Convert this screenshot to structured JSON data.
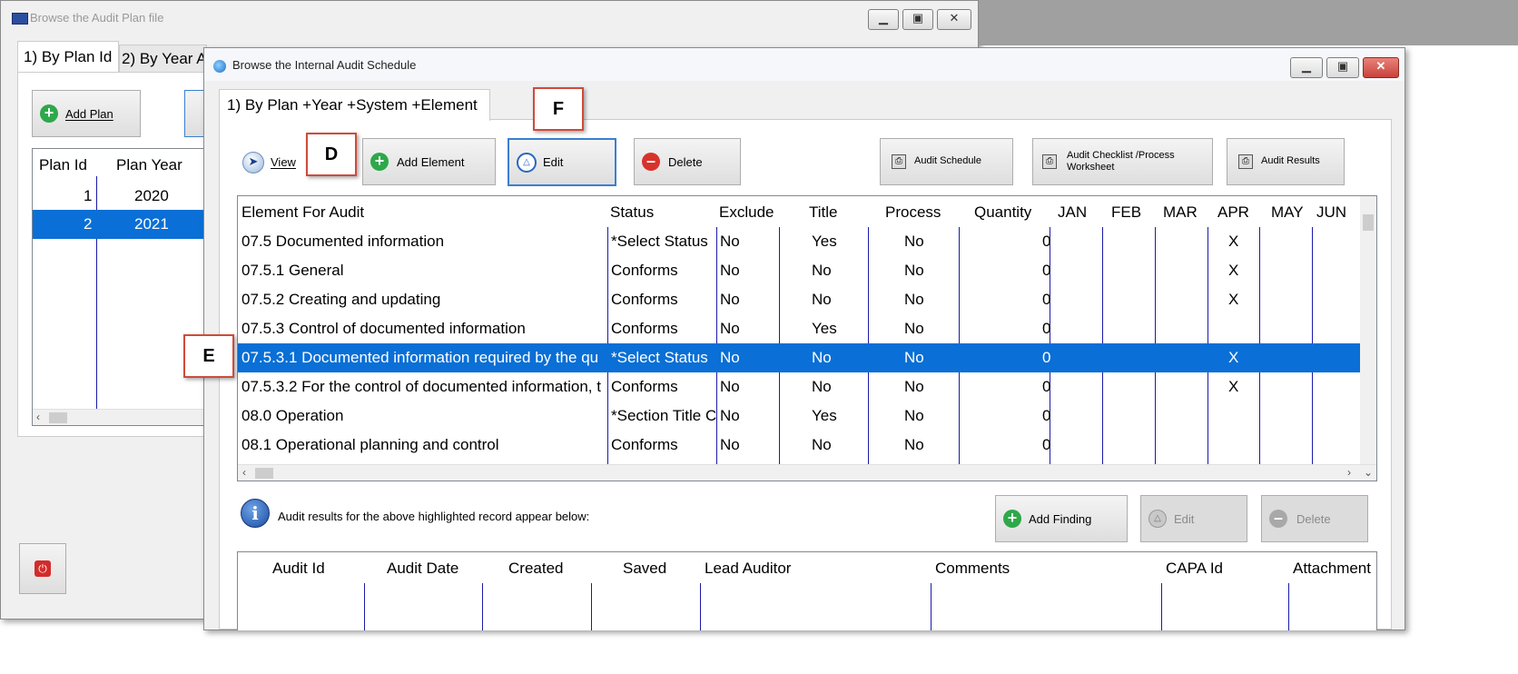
{
  "back_window": {
    "title": "Browse the Audit Plan file",
    "tabs": [
      "1) By Plan Id",
      "2) By Year A"
    ],
    "add_plan_label": "Add Plan",
    "columns": [
      "Plan Id",
      "Plan Year"
    ],
    "rows": [
      {
        "id": "1",
        "year": "2020"
      },
      {
        "id": "2",
        "year": "2021"
      }
    ]
  },
  "front_window": {
    "title": "Browse the Internal Audit Schedule",
    "tab": "1) By Plan +Year +System +Element",
    "toolbar": {
      "view": "View",
      "add_element": "Add Element",
      "edit": "Edit",
      "delete": "Delete",
      "audit_schedule": "Audit Schedule",
      "audit_checklist_line1": "Audit Checklist /Process",
      "audit_checklist_line2": "Worksheet",
      "audit_results": "Audit Results"
    },
    "columns": [
      "Element For Audit",
      "Status",
      "Exclude",
      "Title",
      "Process",
      "Quantity",
      "JAN",
      "FEB",
      "MAR",
      "APR",
      "MAY",
      "JUN"
    ],
    "rows": [
      {
        "element": "07.5 Documented information",
        "status": "*Select Status",
        "exclude": "No",
        "title": "Yes",
        "process": "No",
        "qty": "0",
        "apr": "X"
      },
      {
        "element": "07.5.1 General",
        "status": "Conforms",
        "exclude": "No",
        "title": "No",
        "process": "No",
        "qty": "0",
        "apr": "X"
      },
      {
        "element": "07.5.2 Creating and updating",
        "status": "Conforms",
        "exclude": "No",
        "title": "No",
        "process": "No",
        "qty": "0",
        "apr": "X"
      },
      {
        "element": "07.5.3 Control of documented information",
        "status": "Conforms",
        "exclude": "No",
        "title": "Yes",
        "process": "No",
        "qty": "0",
        "apr": ""
      },
      {
        "element": "07.5.3.1 Documented information required by the qu",
        "status": "*Select Status",
        "exclude": "No",
        "title": "No",
        "process": "No",
        "qty": "0",
        "apr": "X"
      },
      {
        "element": "07.5.3.2 For the control of documented information, t",
        "status": "Conforms",
        "exclude": "No",
        "title": "No",
        "process": "No",
        "qty": "0",
        "apr": "X"
      },
      {
        "element": "08.0 Operation",
        "status": "*Section Title C",
        "exclude": "No",
        "title": "Yes",
        "process": "No",
        "qty": "0",
        "apr": ""
      },
      {
        "element": "08.1 Operational planning and control",
        "status": "Conforms",
        "exclude": "No",
        "title": "No",
        "process": "No",
        "qty": "0",
        "apr": ""
      }
    ],
    "info_text": "Audit results for the above highlighted record appear below:",
    "results_toolbar": {
      "add_finding": "Add Finding",
      "edit": "Edit",
      "delete": "Delete"
    },
    "results_columns": [
      "Audit Id",
      "Audit Date",
      "Created",
      "Saved",
      "Lead Auditor",
      "Comments",
      "CAPA Id",
      "Attachment"
    ]
  },
  "callouts": {
    "d": "D",
    "e": "E",
    "f": "F"
  },
  "colors": {
    "selection": "#0a6fd6",
    "callout_border": "#d04a3a",
    "close_button": "#c9423a"
  }
}
